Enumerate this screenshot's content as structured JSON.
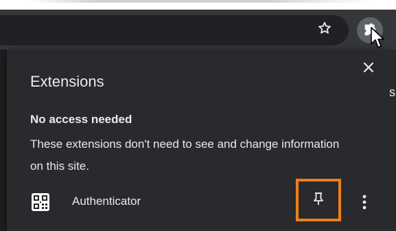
{
  "toolbar": {
    "bookmark_icon": "star-outline-icon",
    "extensions_icon": "puzzle-piece-icon"
  },
  "popup": {
    "title": "Extensions",
    "close_icon": "close-icon",
    "section": {
      "heading": "No access needed",
      "description": "These extensions don't need to see and change information on this site."
    },
    "extensions": [
      {
        "name": "Authenticator",
        "icon": "qr-code-icon",
        "pin_icon": "pin-icon",
        "menu_icon": "more-vert-icon"
      }
    ]
  },
  "page_edge": {
    "sliver_text": "s"
  },
  "colors": {
    "highlight": "#f07f1a",
    "popup_bg": "#292a2d",
    "text": "#e8eaed"
  }
}
